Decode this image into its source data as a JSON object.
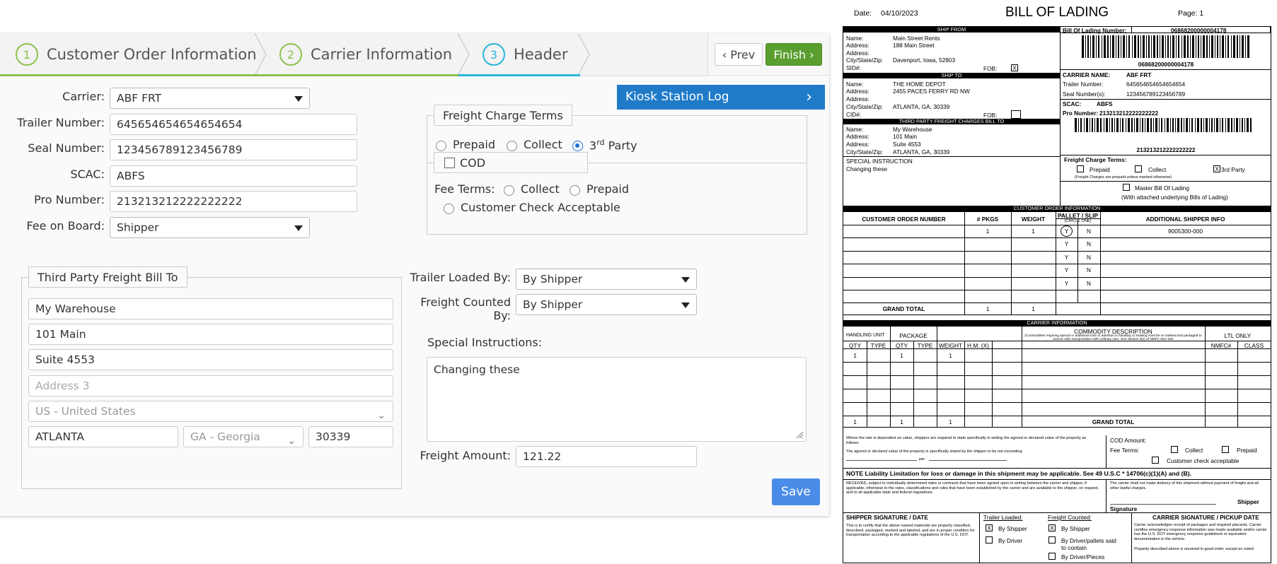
{
  "wizard": {
    "steps": [
      {
        "number": "1",
        "label": "Customer Order Information"
      },
      {
        "number": "2",
        "label": "Carrier Information"
      },
      {
        "number": "3",
        "label": "Header"
      }
    ],
    "prev_label": "‹ Prev",
    "finish_label": "Finish ›"
  },
  "form": {
    "carrier": {
      "label": "Carrier:",
      "value": "ABF FRT"
    },
    "trailer_number": {
      "label": "Trailer Number:",
      "value": "645654654654654654"
    },
    "seal_number": {
      "label": "Seal Number:",
      "value": "123456789123456789"
    },
    "scac": {
      "label": "SCAC:",
      "value": "ABFS"
    },
    "pro_number": {
      "label": "Pro Number:",
      "value": "213213212222222222"
    },
    "fee_on_board": {
      "label": "Fee on Board:",
      "value": "Shipper"
    },
    "third_party": {
      "legend": "Third Party Freight Bill To",
      "name": "My Warehouse",
      "address1": "101 Main",
      "address2": "Suite 4553",
      "address3_placeholder": "Address 3",
      "country": "US - United States",
      "city": "ATLANTA",
      "state": "GA - Georgia",
      "zip": "30339"
    },
    "kiosk_label": "Kiosk Station Log",
    "kiosk_arrow": "›",
    "freight_terms": {
      "legend": "Freight Charge Terms",
      "options": [
        "Prepaid",
        "Collect",
        "3",
        "rd",
        " Party"
      ]
    },
    "cod": {
      "legend": "COD",
      "fee_terms_label": "Fee Terms:",
      "collect": "Collect",
      "prepaid": "Prepaid",
      "customer_check": "Customer Check Acceptable"
    },
    "trailer_loaded_by": {
      "label": "Trailer Loaded By:",
      "value": "By Shipper"
    },
    "freight_counted_by": {
      "label1": "Freight Counted",
      "label2": "By:",
      "value": "By Shipper"
    },
    "special_instructions": {
      "label": "Special Instructions:",
      "value": "Changing these"
    },
    "freight_amount": {
      "label": "Freight Amount:",
      "value": "121.22"
    },
    "save_label": "Save"
  },
  "bol": {
    "date_label": "Date:",
    "date": "04/10/2023",
    "title": "BILL OF LADING",
    "page": "Page: 1",
    "ship_from": {
      "header": "SHIP FROM",
      "name_l": "Name:",
      "name": "Main Street Rents",
      "addr_l": "Address:",
      "addr1": "188 Main Street",
      "addr2_l": "Address:",
      "csz_l": "City/State/Zip:",
      "csz": "Davenport, Iowa, 52803",
      "sid_l": "SID#:",
      "fob_l": "FOB:",
      "fob_mark": "X"
    },
    "ship_to": {
      "header": "SHIP TO",
      "name_l": "Name:",
      "name": "THE HOME DEPOT",
      "addr_l": "Address:",
      "addr1": "2455 PACES FERRY RD NW",
      "addr2_l": "Address:",
      "csz_l": "City/State/Zip:",
      "csz": "ATLANTA, GA, 30339",
      "cid_l": "CID#:",
      "fob_l": "FOB:"
    },
    "third_party": {
      "header": "THIRD PARTY FREIGHT CHARGES BILL TO",
      "name_l": "Name:",
      "name": "My Warehouse",
      "addr_l": "Address:",
      "addr1": "101 Main",
      "addr2_l": "Address:",
      "addr2": "Suite 4553",
      "csz_l": "City/State/Zip:",
      "csz": "ATLANTA, GA, 30339"
    },
    "special_instruction_label": "SPECIAL INSTRUCTION",
    "special_instruction": "Changing these",
    "bol_number_label": "Bill Of Lading Number:",
    "bol_number": "06868200000004178",
    "carrier_name_label": "CARRIER NAME:",
    "carrier_name": "ABF FRT",
    "trailer_label": "Trailer Number:",
    "trailer": "645654654654654654",
    "seal_label": "Seal Number(s):",
    "seal": "123456789123456789",
    "scac_label": "SCAC:",
    "scac": "ABFS",
    "pro_label": "Pro Number:",
    "pro": "213213212222222222",
    "fct": {
      "label": "Freight Charge Terms:",
      "prepaid": "Prepaid",
      "collect": "Collect",
      "third": "3rd Party",
      "third_mark": "X",
      "note": "(Freight Charges are prepaid unless marked otherwise)",
      "master": "Master Bill Of Lading",
      "master_note": "(With attached underlying Bills of Lading)"
    },
    "coi": {
      "header": "CUSTOMER ORDER INFORMATION",
      "col_order": "CUSTOMER ORDER NUMBER",
      "col_pkgs": "# PKGS",
      "col_weight": "WEIGHT",
      "col_pallet": "PALLET / SLIP",
      "col_circle": "(CIRCLE ONE)",
      "col_info": "ADDITIONAL SHIPPER INFO",
      "row1_pkgs": "1",
      "row1_weight": "1",
      "row1_info": "9005300-000",
      "y": "Y",
      "n": "N",
      "grand_total": "GRAND TOTAL",
      "total_pkgs": "1",
      "total_weight": "1"
    },
    "ci": {
      "header": "CARRIER INFORMATION",
      "handling_unit": "HANDLING UNIT",
      "package": "PACKAGE",
      "commodity": "COMMODITY DESCRIPTION",
      "commodity_note": "(Commodities requiring special or additional care or attention in handling or stowing must be so marked and packaged to ensure safe transportation with ordinary care. See Section 2(e) of NMFC item 360",
      "ltl": "LTL ONLY",
      "qty": "QTY",
      "type": "TYPE",
      "weight": "WEIGHT",
      "hm": "H.M. (X)",
      "nmfc": "NMFC#",
      "class": "CLASS",
      "row1_hqty": "1",
      "row1_pqty": "1",
      "row1_weight": "1",
      "grand_total": "GRAND TOTAL",
      "total_hqty": "1",
      "total_pqty": "1",
      "total_weight": "1"
    },
    "value_text1": "Where the rate is dependent on value, shippers are required to state specifically in writing the agreed or declared value of the property as follows:",
    "value_text2": "The agreed or declared value of the property is specifically stated by the shipper to be not exceeding",
    "value_per": "per",
    "cod_amount": "COD Amount:",
    "cod_fee_terms": "Fee Terms:",
    "cod_collect": "Collect",
    "cod_prepaid": "Prepaid",
    "cod_check": "Customer check acceptable",
    "note_liability": "NOTE Liability Limitation for loss or damage in this shipment may be applicable.  See 49 U.S.C * 14706(c)(1)(A) and (B).",
    "received_text": "RECEIVED, subject to individually determined rates or contracts that have been agreed upon in writing between the carrier and shipper, if applicable, otherwise to the rates, classifications and rules that have been established by the carrier and are available to the shipper, on request, and to all applicable state and federal regulations.",
    "carrier_no_delivery": "The carrier shall not make delivery of this shipment without payment of freight and all other lawful charges.",
    "shipper_label": "Shipper",
    "signature_label": "Signature",
    "shipper_sig": "SHIPPER SIGNATURE  / DATE",
    "shipper_sig_text": "This is to certify that the above named materials are properly classified, described, packaged, marked and labeled, and are in proper condition for transportation according to the applicable regulations of the U.S. DOT.",
    "trailer_loaded": "Trailer Loaded:",
    "tl_shipper": "By Shipper",
    "tl_driver": "By Driver",
    "freight_counted": "Freight Counted:",
    "fc_shipper": "By Shipper",
    "fc_driver_pallets": "By Driver/pallets said to contain",
    "fc_driver_pieces": "By Driver/Pieces",
    "mark_x": "X",
    "carrier_sig": "CARRIER SIGNATURE  / PICKUP DATE",
    "carrier_sig_text": "Carrier acknowledges receipt of packages and required placards. Carrier certifies emergency response information was made available and/or carrier has the U.S. DOT emergency response guidebook or equivalent documentation in the vehicle.",
    "carrier_sig_text2": "Property described above is received in good order, except as noted"
  },
  "colors": {
    "accent_green": "#8cc14c",
    "accent_blue": "#29b6d8",
    "finish": "#5a9e2f",
    "kiosk": "#1f7bc8",
    "save": "#4a8de8"
  }
}
